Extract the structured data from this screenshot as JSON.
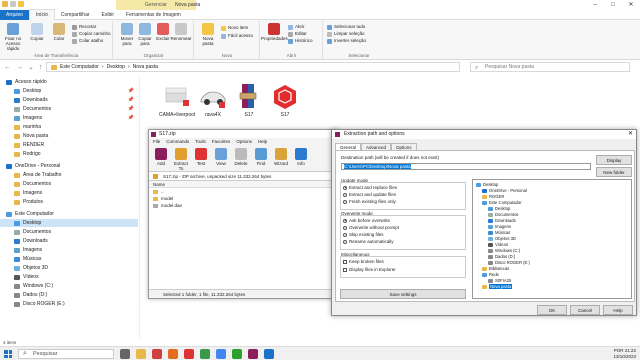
{
  "window": {
    "title": "Nova pasta",
    "context_tab": "Gerenciar"
  },
  "ribbon_tabs": [
    "Arquivo",
    "Início",
    "Compartilhar",
    "Exibir",
    "Ferramentas de Imagem"
  ],
  "ribbon": {
    "clipboard": {
      "pin": "Fixar no Acesso rápido",
      "copy": "Copiar",
      "paste": "Colar",
      "cut": "Recortar",
      "copy_path": "Copiar caminho",
      "paste_shortcut": "Colar atalho",
      "caption": "Área de Transferência"
    },
    "organize": {
      "move": "Mover para",
      "copy_to": "Copiar para",
      "delete": "Excluir",
      "rename": "Renomear",
      "caption": "Organizar"
    },
    "new": {
      "new_folder": "Nova pasta",
      "new_item": "Novo item",
      "easy_access": "Fácil acesso",
      "caption": "Novo"
    },
    "open": {
      "properties": "Propriedades",
      "open": "Abrir",
      "edit": "Editar",
      "history": "Histórico",
      "caption": "Abrir"
    },
    "select": {
      "select_all": "Selecionar tudo",
      "select_none": "Limpar seleção",
      "invert": "Inverter seleção",
      "caption": "Selecionar"
    }
  },
  "address": {
    "path": [
      "Este Computador",
      "Desktop",
      "Nova pasta"
    ],
    "search_placeholder": "Pesquisar Nova pasta"
  },
  "sidebar": {
    "items": [
      {
        "label": "Acesso rápido",
        "icon": "star-icon"
      },
      {
        "label": "Desktop",
        "icon": "desktop-icon"
      },
      {
        "label": "Downloads",
        "icon": "download-icon"
      },
      {
        "label": "Documentos",
        "icon": "document-icon"
      },
      {
        "label": "Imagens",
        "icon": "image-icon"
      },
      {
        "label": "marinha",
        "icon": "folder-icon"
      },
      {
        "label": "Nova pasta",
        "icon": "folder-icon"
      },
      {
        "label": "RENDER",
        "icon": "folder-icon"
      },
      {
        "label": "Rodrigo",
        "icon": "folder-icon"
      },
      {
        "label": "OneDrive - Personal",
        "icon": "cloud-icon"
      },
      {
        "label": "Área de Trabalho",
        "icon": "folder-icon"
      },
      {
        "label": "Documentos",
        "icon": "folder-icon"
      },
      {
        "label": "Imagens",
        "icon": "folder-icon"
      },
      {
        "label": "Produtos",
        "icon": "folder-icon"
      },
      {
        "label": "Este Computador",
        "icon": "computer-icon"
      },
      {
        "label": "Desktop",
        "icon": "desktop-icon"
      },
      {
        "label": "Documentos",
        "icon": "document-icon"
      },
      {
        "label": "Downloads",
        "icon": "download-icon"
      },
      {
        "label": "Imagens",
        "icon": "image-icon"
      },
      {
        "label": "Músicas",
        "icon": "music-icon"
      },
      {
        "label": "Objetos 3D",
        "icon": "cube-icon"
      },
      {
        "label": "Vídeos",
        "icon": "video-icon"
      },
      {
        "label": "Windows (C:)",
        "icon": "drive-icon"
      },
      {
        "label": "Dados (D:)",
        "icon": "drive-icon"
      },
      {
        "label": "Disco ROGER (E:)",
        "icon": "drive-icon"
      }
    ]
  },
  "files": [
    {
      "name": "CAMA+liverpool",
      "icon": "3d-model-icon"
    },
    {
      "name": "rava4X",
      "icon": "car-model-icon"
    },
    {
      "name": "S17",
      "icon": "winrar-icon"
    },
    {
      "name": "S17",
      "icon": "sketchup-icon"
    }
  ],
  "status": "4 itens",
  "rar": {
    "title": "S17.zip",
    "menu": [
      "File",
      "Commands",
      "Tools",
      "Favorites",
      "Options",
      "Help"
    ],
    "tools": [
      "Add",
      "Extract To",
      "Test",
      "View",
      "Delete",
      "Find",
      "Wizard",
      "Info"
    ],
    "path": "S17.zip - ZIP archive, unpacked size 11.332.264 bytes",
    "header": "Name",
    "rows": [
      "..",
      "model",
      "model.dae"
    ],
    "status": "Selected 1 folder, 1 file, 11.332.264 bytes"
  },
  "dialog": {
    "title": "Extraction path and options",
    "tabs": [
      "General",
      "Advanced",
      "Options"
    ],
    "dest_label": "Destination path (will be created if does not exist)",
    "dest_value": "C:\\Users\\PC\\Desktop\\Nova pasta",
    "display_btn": "Display",
    "new_folder_btn": "New folder",
    "update_mode": {
      "title": "Update mode",
      "options": [
        "Extract and replace files",
        "Extract and update files",
        "Fresh existing files only"
      ]
    },
    "overwrite_mode": {
      "title": "Overwrite mode",
      "options": [
        "Ask before overwrite",
        "Overwrite without prompt",
        "Skip existing files",
        "Rename automatically"
      ]
    },
    "misc": {
      "title": "Miscellaneous",
      "options": [
        "Keep broken files",
        "Display files in Explorer"
      ]
    },
    "save_btn": "Save settings",
    "tree": [
      "Desktop",
      "OneDrive - Personal",
      "ROGER",
      "Este Computador",
      "Desktop",
      "Documentos",
      "Downloads",
      "Imagens",
      "Músicas",
      "Objetos 3D",
      "Vídeos",
      "Windows (C:)",
      "Dados (D:)",
      "Disco ROGER (E:)",
      "Bibliotecas",
      "Rede",
      "S0FIA25",
      "Nova pasta"
    ],
    "ok": "OK",
    "cancel": "Cancel",
    "help": "Help"
  },
  "taskbar": {
    "search": "Pesquisar",
    "time": "21:22",
    "date": "13/10/2023",
    "lang": "POR"
  }
}
